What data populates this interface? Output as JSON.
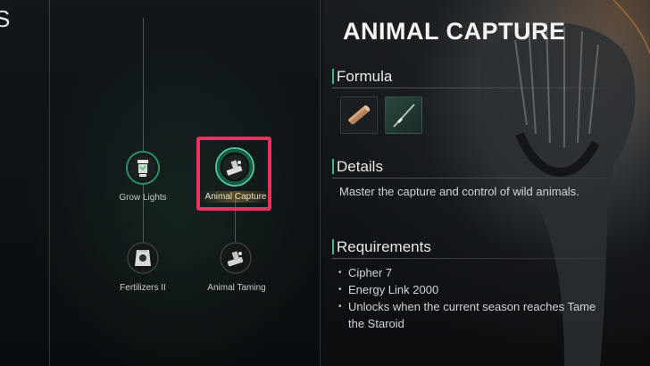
{
  "tree": {
    "heading": "S",
    "nodes": [
      {
        "name": "Grow Lights",
        "icon": "grow-light-icon"
      },
      {
        "name": "Animal Capture",
        "icon": "capture-device-icon",
        "selected": true
      },
      {
        "name": "Fertilizers II",
        "icon": "fertilizer-bag-icon"
      },
      {
        "name": "Animal Taming",
        "icon": "taming-device-icon"
      }
    ]
  },
  "details": {
    "title": "ANIMAL CAPTURE",
    "formula_heading": "Formula",
    "formula_items": [
      {
        "icon": "wood-log-icon"
      },
      {
        "icon": "metal-rod-icon"
      }
    ],
    "details_heading": "Details",
    "description": "Master the capture and control of wild animals.",
    "requirements_heading": "Requirements",
    "requirements": [
      "Cipher 7",
      "Energy Link 2000",
      "Unlocks when the current season reaches Tame the Staroid"
    ]
  },
  "colors": {
    "selection_border": "#ee2f5f",
    "section_accent": "#3fb58c",
    "node_ring": "#4fdcaa"
  }
}
